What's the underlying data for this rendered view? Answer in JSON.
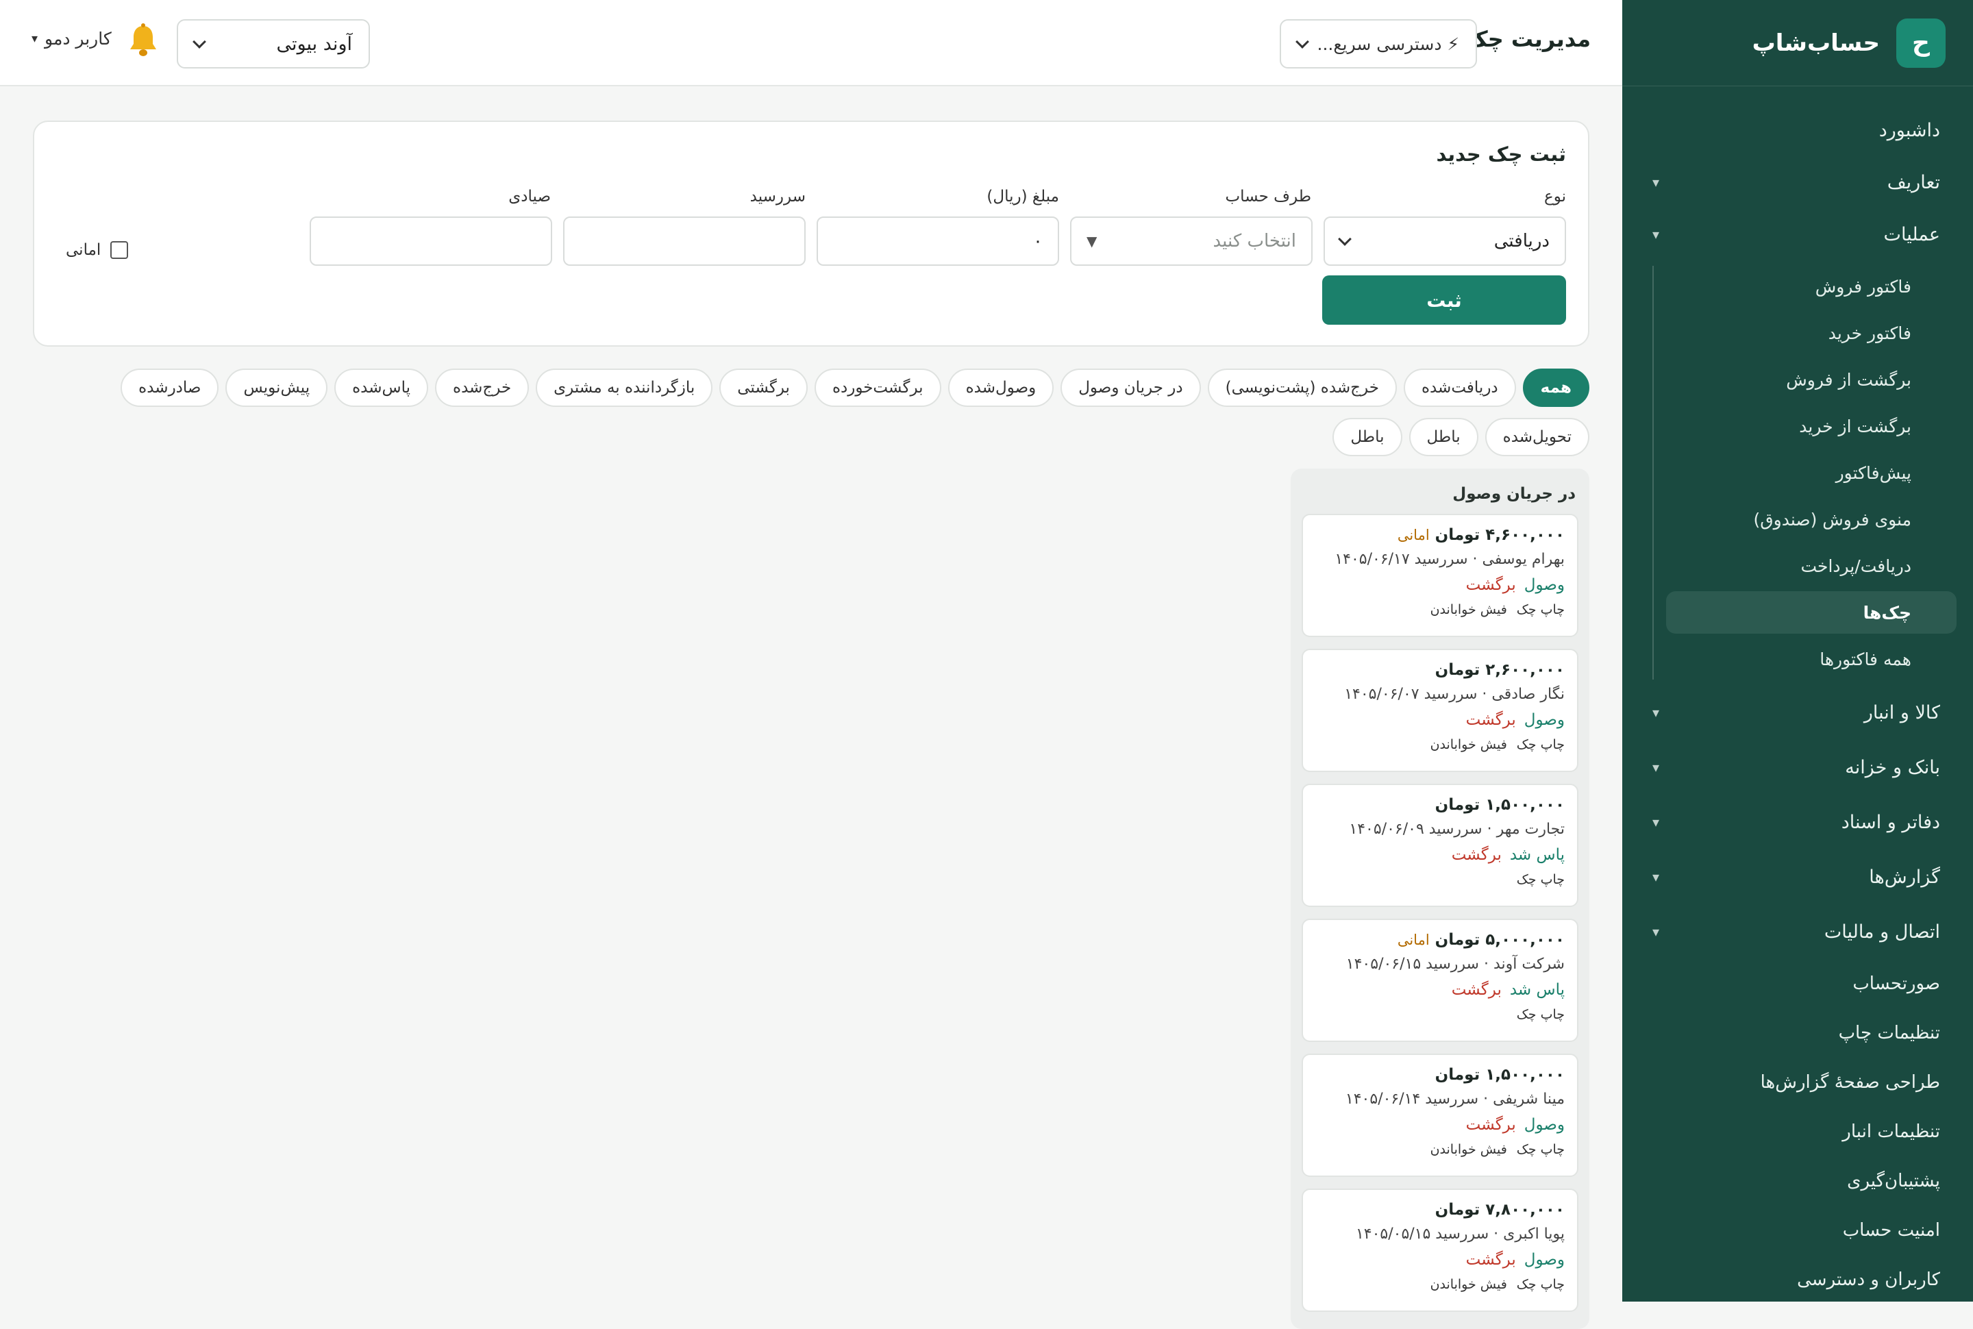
{
  "brand": {
    "logo_letter": "ح",
    "name": "حساب‌شاپ"
  },
  "sidebar": {
    "items": [
      {
        "label": "داشبورد"
      },
      {
        "label": "تعاریف",
        "chevron": "▾"
      },
      {
        "label": "عملیات",
        "chevron": "▾"
      }
    ],
    "operations_sub": [
      {
        "label": "فاکتور فروش"
      },
      {
        "label": "فاکتور خرید"
      },
      {
        "label": "برگشت از فروش"
      },
      {
        "label": "برگشت از خرید"
      },
      {
        "label": "پیش‌فاکتور"
      },
      {
        "label": "منوی فروش (صندوق)"
      },
      {
        "label": "دریافت/پرداخت"
      },
      {
        "label": "چک‌ها",
        "active": true
      },
      {
        "label": "همه فاکتورها"
      }
    ],
    "groups": [
      {
        "label": "کالا و انبار",
        "chevron": "▾"
      },
      {
        "label": "بانک و خزانه",
        "chevron": "▾"
      },
      {
        "label": "دفاتر و اسناد",
        "chevron": "▾"
      },
      {
        "label": "گزارش‌ها",
        "chevron": "▾"
      },
      {
        "label": "اتصال و مالیات",
        "chevron": "▾"
      }
    ],
    "plain": [
      {
        "label": "صورتحساب"
      },
      {
        "label": "تنظیمات چاپ"
      },
      {
        "label": "طراحی صفحهٔ گزارش‌ها"
      },
      {
        "label": "تنظیمات انبار"
      },
      {
        "label": "پشتیبان‌گیری"
      },
      {
        "label": "امنیت حساب"
      },
      {
        "label": "کاربران و دسترسی"
      }
    ]
  },
  "header": {
    "title": "مدیریت چک‌ها",
    "quick_access": "⚡ دسترسی سریع...",
    "company": "آوند بیوتی",
    "user": "کاربر دمو",
    "user_caret": "▾"
  },
  "form": {
    "title": "ثبت چک جدید",
    "type_label": "نوع",
    "type_value": "دریافتی",
    "party_label": "طرف حساب",
    "party_placeholder": "انتخاب کنید",
    "amount_label": "مبلغ (ریال)",
    "amount_value": "۰",
    "due_label": "سررسید",
    "due_value": "",
    "sayadi_label": "صیادی",
    "sayadi_value": "",
    "amanat_label": "امانی",
    "submit": "ثبت"
  },
  "filters": [
    {
      "label": "همه",
      "active": true
    },
    {
      "label": "دریافت‌شده"
    },
    {
      "label": "خرج‌شده (پشت‌نویسی)"
    },
    {
      "label": "در جریان وصول"
    },
    {
      "label": "وصول‌شده"
    },
    {
      "label": "برگشت‌خورده"
    },
    {
      "label": "برگشتی"
    },
    {
      "label": "بازگرداننده به مشتری"
    },
    {
      "label": "خرج‌شده"
    },
    {
      "label": "پاس‌شده"
    },
    {
      "label": "پیش‌نویس"
    },
    {
      "label": "صادرشده"
    },
    {
      "label": "تحویل‌شده"
    },
    {
      "label": "باطل"
    },
    {
      "label": "باطل"
    }
  ],
  "column": {
    "title": "در جریان وصول",
    "cards": [
      {
        "amount": "۴,۶۰۰,۰۰۰ تومان",
        "tag": "امانی",
        "sub": "بهرام یوسفی · سررسید ۱۴۰۵/۰۶/۱۷",
        "primary": "وصول",
        "secondary": "برگشت",
        "link1": "چاپ چک",
        "link2": "فیش خواباندن"
      },
      {
        "amount": "۲,۶۰۰,۰۰۰ تومان",
        "tag": "",
        "sub": "نگار صادقی · سررسید ۱۴۰۵/۰۶/۰۷",
        "primary": "وصول",
        "secondary": "برگشت",
        "link1": "چاپ چک",
        "link2": "فیش خواباندن"
      },
      {
        "amount": "۱,۵۰۰,۰۰۰ تومان",
        "tag": "",
        "sub": "تجارت مهر · سررسید ۱۴۰۵/۰۶/۰۹",
        "primary": "پاس شد",
        "secondary": "برگشت",
        "link1": "چاپ چک",
        "link2": ""
      },
      {
        "amount": "۵,۰۰۰,۰۰۰ تومان",
        "tag": "امانی",
        "sub": "شرکت آوند · سررسید ۱۴۰۵/۰۶/۱۵",
        "primary": "پاس شد",
        "secondary": "برگشت",
        "link1": "چاپ چک",
        "link2": ""
      },
      {
        "amount": "۱,۵۰۰,۰۰۰ تومان",
        "tag": "",
        "sub": "مینا شریفی · سررسید ۱۴۰۵/۰۶/۱۴",
        "primary": "وصول",
        "secondary": "برگشت",
        "link1": "چاپ چک",
        "link2": "فیش خواباندن"
      },
      {
        "amount": "۷,۸۰۰,۰۰۰ تومان",
        "tag": "",
        "sub": "پویا اکبری · سررسید ۱۴۰۵/۰۵/۱۵",
        "primary": "وصول",
        "secondary": "برگشت",
        "link1": "چاپ چک",
        "link2": "فیش خواباندن"
      }
    ]
  },
  "colors": {
    "sidebar_bg": "#1a4a40",
    "accent": "#1b806b",
    "danger": "#c0392b",
    "amanat_tag": "#b26a00"
  }
}
